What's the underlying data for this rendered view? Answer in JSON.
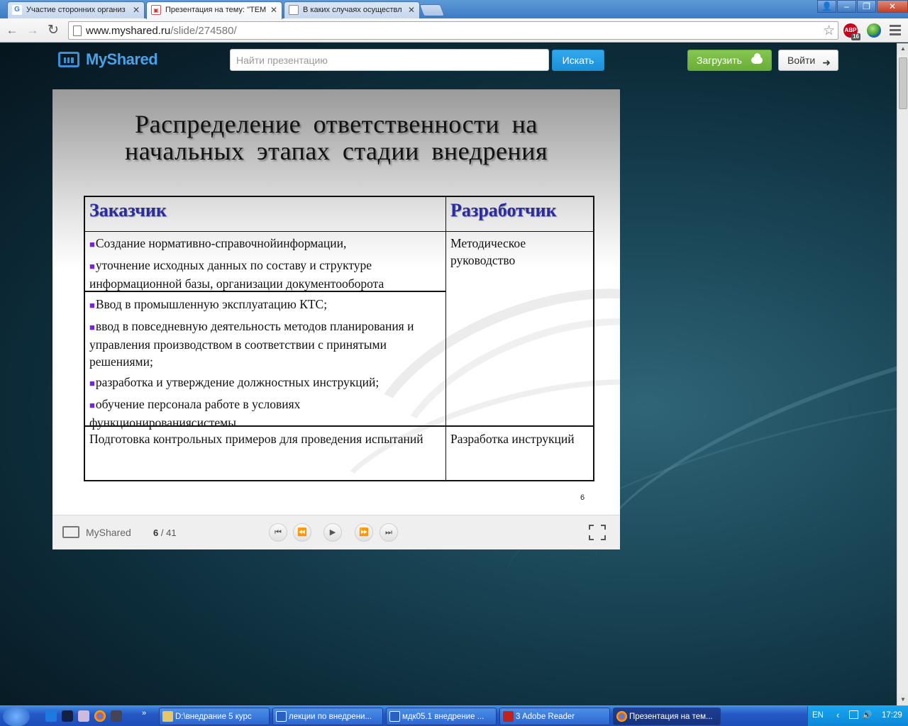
{
  "browser": {
    "tabs": [
      {
        "title": "Участие сторонних организ",
        "icon": "google-icon",
        "active": false
      },
      {
        "title": "Презентация на тему: \"ТЕМ",
        "icon": "presentation-icon",
        "active": true
      },
      {
        "title": "В каких случаях осуществл",
        "icon": "document-icon",
        "active": false
      }
    ],
    "url_domain": "www.myshared.ru",
    "url_path": "/slide/274580/",
    "abp_badge": "16",
    "abp_label": "ABP"
  },
  "site": {
    "logo": "MyShared",
    "search_placeholder": "Найти презентацию",
    "search_button": "Искать",
    "upload_button": "Загрузить",
    "login_button": "Войти"
  },
  "slide": {
    "title_line1": "Распределение  ответственности  на",
    "title_line2": "начальных  этапах  стадии  внедрения",
    "col_customer": "Заказчик",
    "col_developer": "Разработчик",
    "row1_customer": [
      "Создание нормативно-справочнойинформации,",
      "уточнение исходных данных по составу и структуре информационной базы, организации документооборота"
    ],
    "row1_developer": "Методическое руководство",
    "row2_customer": [
      "Ввод в промышленную эксплуатацию КТС;",
      "ввод в повседневную деятельность методов планирования и управления производством в соответствии с принятыми решениями;",
      "разработка и утверждение должностных инструкций;",
      "обучение персонала работе в условиях функционированиясистемы"
    ],
    "row3_customer": "Подготовка контрольных примеров для проведения испытаний",
    "row3_developer": "Разработка инструкций",
    "page_number": "6"
  },
  "player": {
    "logo": "MyShared",
    "current": "6",
    "separator": "/ 41"
  },
  "taskbar": {
    "items": [
      {
        "label": "D:\\внедрание 5 курс",
        "icon": "folder-icon"
      },
      {
        "label": "лекции по внедрени...",
        "icon": "word-icon"
      },
      {
        "label": "мдк05.1 внедрение ...",
        "icon": "word-icon"
      },
      {
        "label": "3 Adobe Reader",
        "icon": "adobe-reader-icon"
      },
      {
        "label": "Презентация на тем...",
        "icon": "chrome-icon"
      }
    ],
    "language": "EN",
    "time": "17:29"
  },
  "colors": {
    "accent_blue": "#1a90d8",
    "upload_green": "#6aae36",
    "heading_blue": "#2b2ba0",
    "bullet_purple": "#7b22e0"
  }
}
